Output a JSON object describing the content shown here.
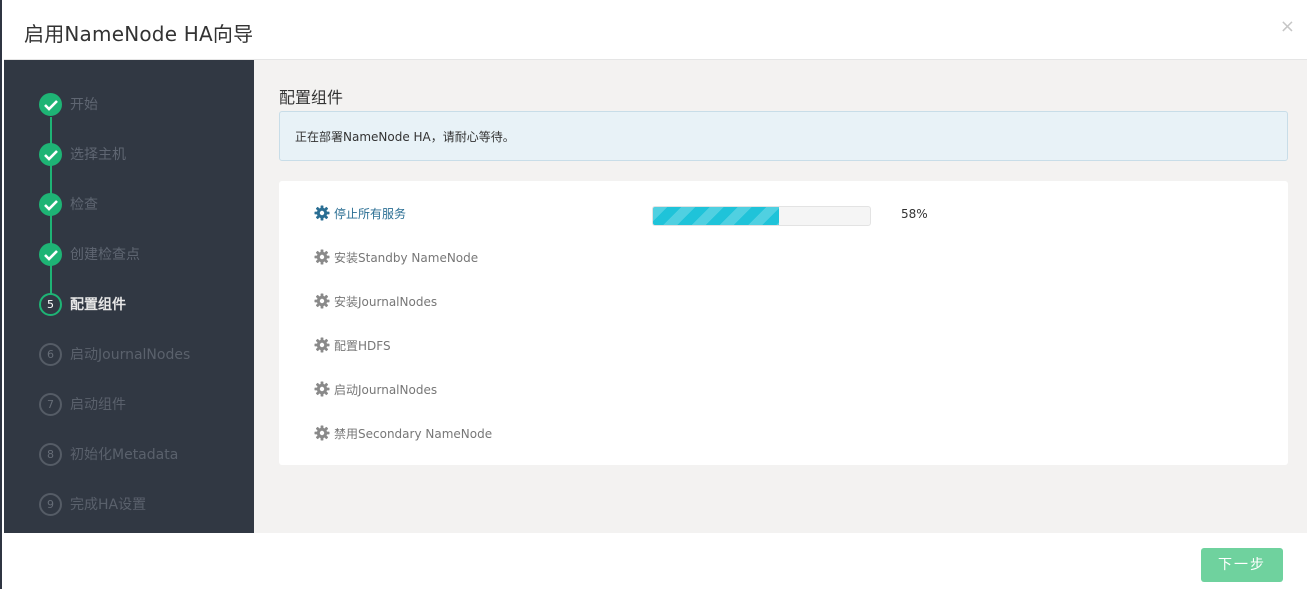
{
  "dialog": {
    "title": "启用NameNode HA向导",
    "close_label": "×"
  },
  "steps": [
    {
      "number": "1",
      "label": "开始",
      "state": "done"
    },
    {
      "number": "2",
      "label": "选择主机",
      "state": "done"
    },
    {
      "number": "3",
      "label": "检查",
      "state": "done"
    },
    {
      "number": "4",
      "label": "创建检查点",
      "state": "done"
    },
    {
      "number": "5",
      "label": "配置组件",
      "state": "current"
    },
    {
      "number": "6",
      "label": "启动JournalNodes",
      "state": "future"
    },
    {
      "number": "7",
      "label": "启动组件",
      "state": "future"
    },
    {
      "number": "8",
      "label": "初始化Metadata",
      "state": "future"
    },
    {
      "number": "9",
      "label": "完成HA设置",
      "state": "future"
    }
  ],
  "main": {
    "section_title": "配置组件",
    "alert_text": "正在部署NameNode HA，请耐心等待。",
    "tasks": [
      {
        "label": "停止所有服务",
        "status": "in-progress"
      },
      {
        "label": "安装Standby NameNode",
        "status": "pending"
      },
      {
        "label": "安装JournalNodes",
        "status": "pending"
      },
      {
        "label": "配置HDFS",
        "status": "pending"
      },
      {
        "label": "启动JournalNodes",
        "status": "pending"
      },
      {
        "label": "禁用Secondary NameNode",
        "status": "pending"
      }
    ],
    "progress_value": 58,
    "progress_text": "58%"
  },
  "footer": {
    "next_label": "下一步"
  },
  "colors": {
    "sidebar_bg": "#313843",
    "success": "#1eb475",
    "progress": "#1fc3d9",
    "active_task": "#2a6e93",
    "next_button": "#6fd29e"
  },
  "icons": {
    "done_step": "check-icon",
    "task": "gear-icon",
    "close": "close-icon"
  }
}
